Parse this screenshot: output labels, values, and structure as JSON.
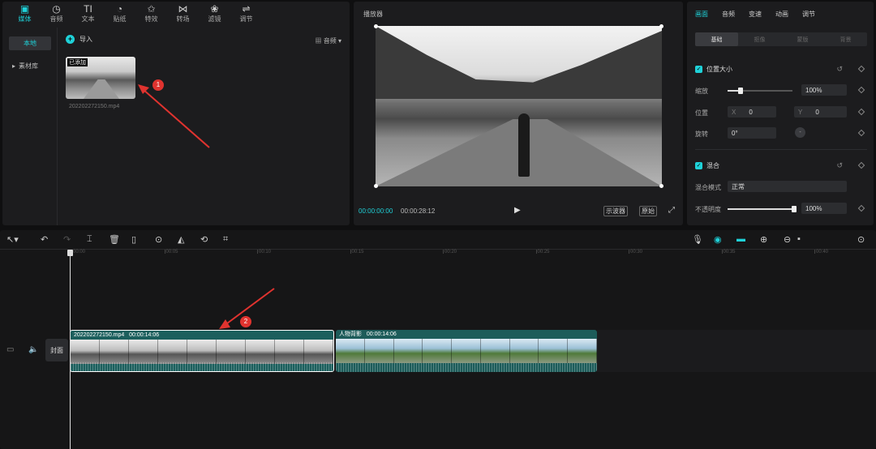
{
  "toolbar": {
    "tools": [
      {
        "label": "媒体",
        "icon": "media-icon",
        "glyph": "▣"
      },
      {
        "label": "音频",
        "icon": "audio-icon",
        "glyph": "◷"
      },
      {
        "label": "文本",
        "icon": "text-icon",
        "glyph": "TI"
      },
      {
        "label": "贴纸",
        "icon": "sticker-icon",
        "glyph": "◔"
      },
      {
        "label": "特效",
        "icon": "effects-icon",
        "glyph": "✩"
      },
      {
        "label": "转场",
        "icon": "transition-icon",
        "glyph": "⋈"
      },
      {
        "label": "滤镜",
        "icon": "filter-icon",
        "glyph": "❀"
      },
      {
        "label": "调节",
        "icon": "adjust-icon",
        "glyph": "⇌"
      }
    ]
  },
  "media": {
    "sidebar": [
      "本地",
      "素材库"
    ],
    "import_label": "导入",
    "sort_label": "音频",
    "clip": {
      "badge": "已添加",
      "duration": "",
      "filename": "202202272150.mp4"
    }
  },
  "player": {
    "title": "播放器",
    "current_time": "00:00:00:00",
    "total_time": "00:00:28:12",
    "btn_ratio": "示波器",
    "btn_original": "原始"
  },
  "inspector": {
    "tabs": [
      "画面",
      "音频",
      "变速",
      "动画",
      "调节"
    ],
    "subtabs": [
      "基础",
      "抠像",
      "蒙版",
      "背景"
    ],
    "section_position": "位置大小",
    "scale_label": "缩放",
    "scale_value": "100%",
    "scale_level": 0.2,
    "position_label": "位置",
    "pos_x_prefix": "X",
    "pos_x": "0",
    "pos_y_prefix": "Y",
    "pos_y": "0",
    "rotate_label": "旋转",
    "rotate_value": "0°",
    "rotate_dial": "-",
    "section_blend": "混合",
    "blend_mode_label": "混合模式",
    "blend_mode_value": "正常",
    "opacity_label": "不透明度",
    "opacity_value": "100%",
    "opacity_level": 1.0
  },
  "timeline": {
    "ruler": [
      "00:00",
      "00:05",
      "00:10",
      "00:15",
      "00:20",
      "00:25",
      "00:30",
      "00:35",
      "00:40"
    ],
    "cover_label": "封面",
    "clips": [
      {
        "name": "202202272150.mp4",
        "duration": "00:00:14:06"
      },
      {
        "name": "人物背影",
        "duration": "00:00:14:06"
      }
    ]
  },
  "annotations": {
    "one": "1",
    "two": "2"
  },
  "colors": {
    "accent": "#1fd1d8",
    "clip": "#1c5f5d",
    "marker": "#e0332f"
  }
}
